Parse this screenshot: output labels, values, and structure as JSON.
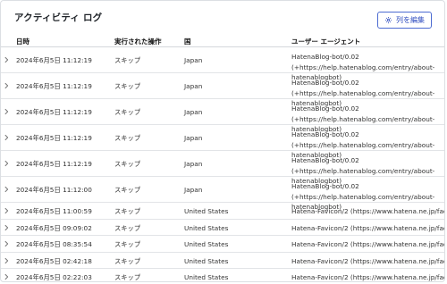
{
  "panel": {
    "title": "アクティビティ ログ",
    "edit_columns_label": "列を編集"
  },
  "table": {
    "columns": [
      "日時",
      "実行された操作",
      "国",
      "ユーザー エージェント"
    ],
    "rows": [
      {
        "datetime": "2024年6月5日 11:12:19",
        "action": "スキップ",
        "country": "Japan",
        "user_agent": "HatenaBlog-bot/0.02 (+https://help.hatenablog.com/entry/about-hatenablogbot)"
      },
      {
        "datetime": "2024年6月5日 11:12:19",
        "action": "スキップ",
        "country": "Japan",
        "user_agent": "HatenaBlog-bot/0.02 (+https://help.hatenablog.com/entry/about-hatenablogbot)"
      },
      {
        "datetime": "2024年6月5日 11:12:19",
        "action": "スキップ",
        "country": "Japan",
        "user_agent": "HatenaBlog-bot/0.02 (+https://help.hatenablog.com/entry/about-hatenablogbot)"
      },
      {
        "datetime": "2024年6月5日 11:12:19",
        "action": "スキップ",
        "country": "Japan",
        "user_agent": "HatenaBlog-bot/0.02 (+https://help.hatenablog.com/entry/about-hatenablogbot)"
      },
      {
        "datetime": "2024年6月5日 11:12:19",
        "action": "スキップ",
        "country": "Japan",
        "user_agent": "HatenaBlog-bot/0.02 (+https://help.hatenablog.com/entry/about-hatenablogbot)"
      },
      {
        "datetime": "2024年6月5日 11:12:00",
        "action": "スキップ",
        "country": "Japan",
        "user_agent": "HatenaBlog-bot/0.02 (+https://help.hatenablog.com/entry/about-hatenablogbot)"
      },
      {
        "datetime": "2024年6月5日 11:00:59",
        "action": "スキップ",
        "country": "United States",
        "user_agent": "Hatena-Favicon/2 (https://www.hatena.ne.jp/faq/)"
      },
      {
        "datetime": "2024年6月5日 09:09:02",
        "action": "スキップ",
        "country": "United States",
        "user_agent": "Hatena-Favicon/2 (https://www.hatena.ne.jp/faq/)"
      },
      {
        "datetime": "2024年6月5日 08:35:54",
        "action": "スキップ",
        "country": "United States",
        "user_agent": "Hatena-Favicon/2 (https://www.hatena.ne.jp/faq/)"
      },
      {
        "datetime": "2024年6月5日 02:42:18",
        "action": "スキップ",
        "country": "United States",
        "user_agent": "Hatena-Favicon/2 (https://www.hatena.ne.jp/faq/)"
      },
      {
        "datetime": "2024年6月5日 02:22:03",
        "action": "スキップ",
        "country": "United States",
        "user_agent": "Hatena-Favicon/2 (https://www.hatena.ne.jp/faq/)"
      }
    ]
  },
  "icons": {
    "edit_columns": "gear-icon",
    "expand_row": "chevron-right-icon"
  },
  "colors": {
    "accent": "#2d4bbf",
    "border": "#dcdfe3"
  }
}
